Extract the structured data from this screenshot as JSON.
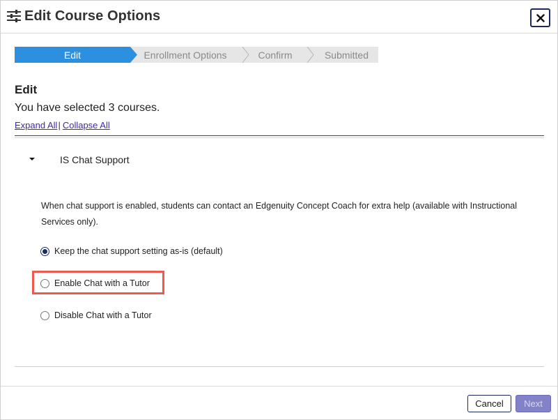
{
  "header": {
    "title": "Edit Course Options",
    "close_icon": "close-icon",
    "title_icon": "sliders-icon"
  },
  "stepper": {
    "steps": [
      {
        "label": "Edit",
        "active": true
      },
      {
        "label": "Enrollment Options",
        "active": false
      },
      {
        "label": "Confirm",
        "active": false
      },
      {
        "label": "Submitted",
        "active": false
      }
    ]
  },
  "edit": {
    "heading": "Edit",
    "selected_text": "You have selected 3 courses.",
    "expand_all": "Expand All",
    "separator": "|",
    "collapse_all": "Collapse All"
  },
  "section": {
    "title": "IS Chat Support",
    "description": "When chat support is enabled, students can contact an Edgenuity Concept Coach for extra help (available with Instructional Services only).",
    "options": [
      {
        "label": "Keep the chat support setting as-is (default)",
        "checked": true
      },
      {
        "label": "Enable Chat with a Tutor",
        "checked": false
      },
      {
        "label": "Disable Chat with a Tutor",
        "checked": false
      }
    ]
  },
  "footer": {
    "cancel_label": "Cancel",
    "next_label": "Next"
  },
  "colors": {
    "accent": "#2c8fe0",
    "highlight": "#ee5a4f",
    "primary_button": "#8382c9",
    "navy": "#1c2a5a"
  }
}
